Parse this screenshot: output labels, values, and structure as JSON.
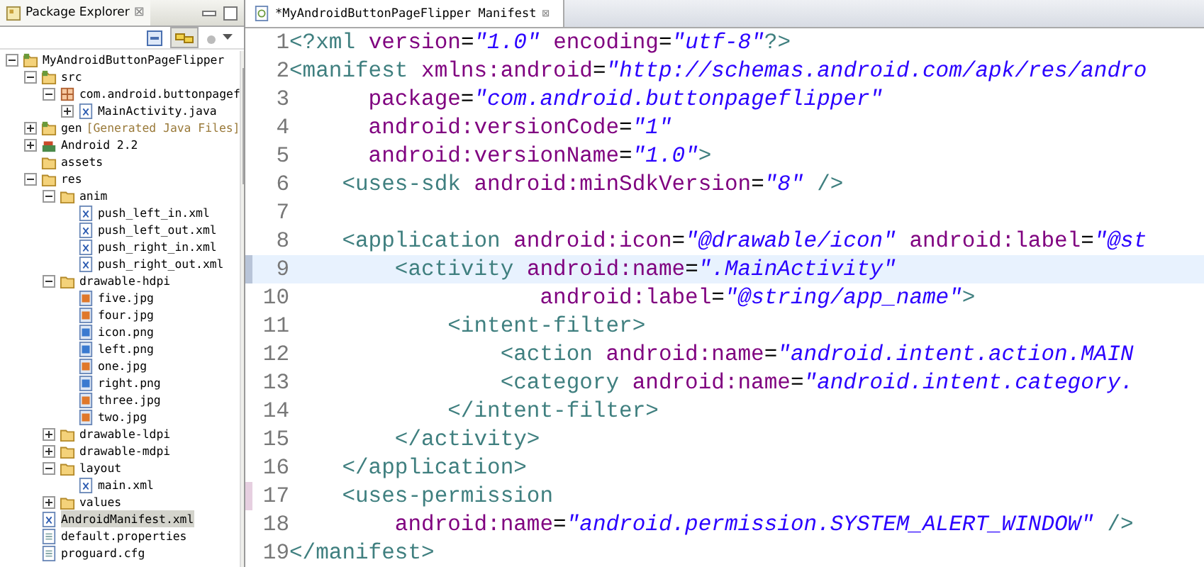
{
  "explorer": {
    "title": "Package Explorer",
    "close": "⊠",
    "tree": [
      {
        "label": "MyAndroidButtonPageFlipper",
        "kind": "project",
        "expanded": true,
        "selected": false,
        "children": [
          {
            "label": "src",
            "kind": "srcfolder",
            "expanded": true,
            "selected": false,
            "children": [
              {
                "label": "com.android.buttonpagef",
                "kind": "package",
                "expanded": true,
                "selected": false,
                "children": [
                  {
                    "label": "MainActivity.java",
                    "kind": "java",
                    "expanded": false,
                    "selected": false
                  }
                ]
              }
            ]
          },
          {
            "label": "gen",
            "decoration": "[Generated Java Files]",
            "kind": "srcfolder",
            "expanded": false,
            "selected": false
          },
          {
            "label": "Android 2.2",
            "kind": "library",
            "expanded": false,
            "selected": false
          },
          {
            "label": "assets",
            "kind": "folder",
            "selected": false
          },
          {
            "label": "res",
            "kind": "folder",
            "expanded": true,
            "selected": false,
            "children": [
              {
                "label": "anim",
                "kind": "folder",
                "expanded": true,
                "selected": false,
                "children": [
                  {
                    "label": "push_left_in.xml",
                    "kind": "xml",
                    "selected": false
                  },
                  {
                    "label": "push_left_out.xml",
                    "kind": "xml",
                    "selected": false
                  },
                  {
                    "label": "push_right_in.xml",
                    "kind": "xml",
                    "selected": false
                  },
                  {
                    "label": "push_right_out.xml",
                    "kind": "xml",
                    "selected": false
                  }
                ]
              },
              {
                "label": "drawable-hdpi",
                "kind": "folder",
                "expanded": true,
                "selected": false,
                "children": [
                  {
                    "label": "five.jpg",
                    "kind": "jpg",
                    "selected": false
                  },
                  {
                    "label": "four.jpg",
                    "kind": "jpg",
                    "selected": false
                  },
                  {
                    "label": "icon.png",
                    "kind": "png",
                    "selected": false
                  },
                  {
                    "label": "left.png",
                    "kind": "png",
                    "selected": false
                  },
                  {
                    "label": "one.jpg",
                    "kind": "jpg",
                    "selected": false
                  },
                  {
                    "label": "right.png",
                    "kind": "png",
                    "selected": false
                  },
                  {
                    "label": "three.jpg",
                    "kind": "jpg",
                    "selected": false
                  },
                  {
                    "label": "two.jpg",
                    "kind": "jpg",
                    "selected": false
                  }
                ]
              },
              {
                "label": "drawable-ldpi",
                "kind": "folder",
                "expanded": false,
                "selected": false
              },
              {
                "label": "drawable-mdpi",
                "kind": "folder",
                "expanded": false,
                "selected": false
              },
              {
                "label": "layout",
                "kind": "folder",
                "expanded": true,
                "selected": false,
                "children": [
                  {
                    "label": "main.xml",
                    "kind": "xml",
                    "selected": false
                  }
                ]
              },
              {
                "label": "values",
                "kind": "folder",
                "expanded": false,
                "selected": false
              }
            ]
          },
          {
            "label": "AndroidManifest.xml",
            "kind": "manifest",
            "selected": true
          },
          {
            "label": "default.properties",
            "kind": "file",
            "selected": false
          },
          {
            "label": "proguard.cfg",
            "kind": "file",
            "selected": false
          }
        ]
      }
    ]
  },
  "editor": {
    "tab": {
      "title": "*MyAndroidButtonPageFlipper Manifest",
      "close": "⊠"
    },
    "lines": [
      {
        "number": "1",
        "current": false,
        "marked": false,
        "tokens": [
          {
            "kind": "tag",
            "text": "<?xml"
          },
          {
            "kind": "attr",
            "text": " version"
          },
          {
            "kind": "plain",
            "text": "="
          },
          {
            "kind": "value",
            "text": "\"1.0\""
          },
          {
            "kind": "attr",
            "text": " encoding"
          },
          {
            "kind": "plain",
            "text": "="
          },
          {
            "kind": "value",
            "text": "\"utf-8\""
          },
          {
            "kind": "tag",
            "text": "?>"
          }
        ]
      },
      {
        "number": "2",
        "current": false,
        "marked": false,
        "tokens": [
          {
            "kind": "tag",
            "text": "<manifest"
          },
          {
            "kind": "attr",
            "text": " xmlns:android"
          },
          {
            "kind": "plain",
            "text": "="
          },
          {
            "kind": "value",
            "text": "\"http://schemas.android.com/apk/res/andro"
          }
        ]
      },
      {
        "number": "3",
        "current": false,
        "marked": false,
        "tokens": [
          {
            "kind": "attr",
            "text": "      package"
          },
          {
            "kind": "plain",
            "text": "="
          },
          {
            "kind": "value",
            "text": "\"com.android.buttonpageflipper\""
          }
        ]
      },
      {
        "number": "4",
        "current": false,
        "marked": false,
        "tokens": [
          {
            "kind": "attr",
            "text": "      android:versionCode"
          },
          {
            "kind": "plain",
            "text": "="
          },
          {
            "kind": "value",
            "text": "\"1\""
          }
        ]
      },
      {
        "number": "5",
        "current": false,
        "marked": false,
        "tokens": [
          {
            "kind": "attr",
            "text": "      android:versionName"
          },
          {
            "kind": "plain",
            "text": "="
          },
          {
            "kind": "value",
            "text": "\"1.0\""
          },
          {
            "kind": "tag",
            "text": ">"
          }
        ]
      },
      {
        "number": "6",
        "current": false,
        "marked": false,
        "tokens": [
          {
            "kind": "tag",
            "text": "    <uses-sdk"
          },
          {
            "kind": "attr",
            "text": " android:minSdkVersion"
          },
          {
            "kind": "plain",
            "text": "="
          },
          {
            "kind": "value",
            "text": "\"8\""
          },
          {
            "kind": "tag",
            "text": " />"
          }
        ]
      },
      {
        "number": "7",
        "current": false,
        "marked": false
      },
      {
        "number": "8",
        "current": false,
        "marked": false,
        "tokens": [
          {
            "kind": "tag",
            "text": "    <application"
          },
          {
            "kind": "attr",
            "text": " android:icon"
          },
          {
            "kind": "plain",
            "text": "="
          },
          {
            "kind": "value",
            "text": "\"@drawable/icon\""
          },
          {
            "kind": "attr",
            "text": " android:label"
          },
          {
            "kind": "plain",
            "text": "="
          },
          {
            "kind": "value",
            "text": "\"@st"
          }
        ]
      },
      {
        "number": "9",
        "current": true,
        "marked": true,
        "tokens": [
          {
            "kind": "tag",
            "text": "        <activity"
          },
          {
            "kind": "attr",
            "text": " android:name"
          },
          {
            "kind": "plain",
            "text": "="
          },
          {
            "kind": "value",
            "text": "\".MainActivity\""
          }
        ]
      },
      {
        "number": "10",
        "current": false,
        "marked": false,
        "tokens": [
          {
            "kind": "attr",
            "text": "                   android:label"
          },
          {
            "kind": "plain",
            "text": "="
          },
          {
            "kind": "value",
            "text": "\"@string/app_name\""
          },
          {
            "kind": "tag",
            "text": ">"
          }
        ]
      },
      {
        "number": "11",
        "current": false,
        "marked": false,
        "tokens": [
          {
            "kind": "tag",
            "text": "            <intent-filter>"
          }
        ]
      },
      {
        "number": "12",
        "current": false,
        "marked": false,
        "tokens": [
          {
            "kind": "tag",
            "text": "                <action"
          },
          {
            "kind": "attr",
            "text": " android:name"
          },
          {
            "kind": "plain",
            "text": "="
          },
          {
            "kind": "value",
            "text": "\"android.intent.action.MAIN"
          }
        ]
      },
      {
        "number": "13",
        "current": false,
        "marked": false,
        "tokens": [
          {
            "kind": "tag",
            "text": "                <category"
          },
          {
            "kind": "attr",
            "text": " android:name"
          },
          {
            "kind": "plain",
            "text": "="
          },
          {
            "kind": "value",
            "text": "\"android.intent.category."
          }
        ]
      },
      {
        "number": "14",
        "current": false,
        "marked": false,
        "tokens": [
          {
            "kind": "tag",
            "text": "            </intent-filter>"
          }
        ]
      },
      {
        "number": "15",
        "current": false,
        "marked": false,
        "tokens": [
          {
            "kind": "tag",
            "text": "        </activity>"
          }
        ]
      },
      {
        "number": "16",
        "current": false,
        "marked": false,
        "tokens": [
          {
            "kind": "tag",
            "text": "    </application>"
          }
        ]
      },
      {
        "number": "17",
        "current": false,
        "marked": true,
        "tokens": [
          {
            "kind": "tag",
            "text": "    <uses-permission"
          }
        ]
      },
      {
        "number": "18",
        "current": false,
        "marked": false,
        "tokens": [
          {
            "kind": "attr",
            "text": "        android:name"
          },
          {
            "kind": "plain",
            "text": "="
          },
          {
            "kind": "value",
            "text": "\"android.permission.SYSTEM_ALERT_WINDOW\""
          },
          {
            "kind": "tag",
            "text": " />"
          }
        ]
      },
      {
        "number": "19",
        "current": false,
        "marked": false,
        "tokens": [
          {
            "kind": "tag",
            "text": "</manifest>"
          }
        ]
      }
    ]
  }
}
